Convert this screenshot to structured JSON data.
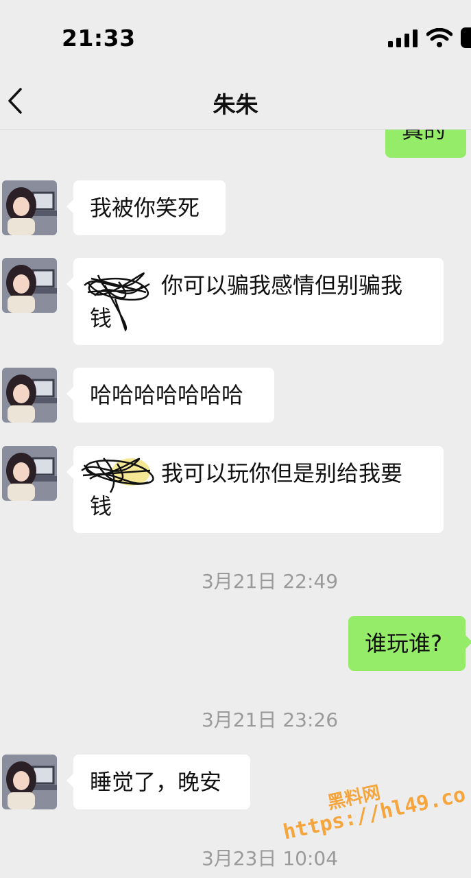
{
  "status_bar": {
    "time": "21:33"
  },
  "nav": {
    "title": "朱朱",
    "back_icon": "chevron-left-icon"
  },
  "messages": [
    {
      "id": "m0",
      "side": "right",
      "text": "真的",
      "partial": true
    },
    {
      "id": "m1",
      "side": "left",
      "text": "我被你笑死"
    },
    {
      "id": "m2",
      "side": "left",
      "line1": "你可以骗我感情但别骗我",
      "line2": "钱",
      "redacted": true
    },
    {
      "id": "m3",
      "side": "left",
      "text": "哈哈哈哈哈哈哈"
    },
    {
      "id": "m4",
      "side": "left",
      "line1": "我可以玩你但是别给我要",
      "line2": "钱",
      "redacted": true
    },
    {
      "id": "m5",
      "side": "right",
      "text": "谁玩谁?"
    },
    {
      "id": "m6",
      "side": "left",
      "text": "睡觉了，晚安"
    }
  ],
  "timestamps": [
    "3月21日 22:49",
    "3月21日 23:26",
    "3月23日 10:04"
  ],
  "watermark": {
    "line1": "黑料网",
    "line2": "https://hl49.co"
  },
  "colors": {
    "background": "#ededed",
    "bubble_other": "#ffffff",
    "bubble_mine": "#95ec69",
    "timestamp": "#9a9a9a",
    "watermark": "#f5a53c"
  }
}
